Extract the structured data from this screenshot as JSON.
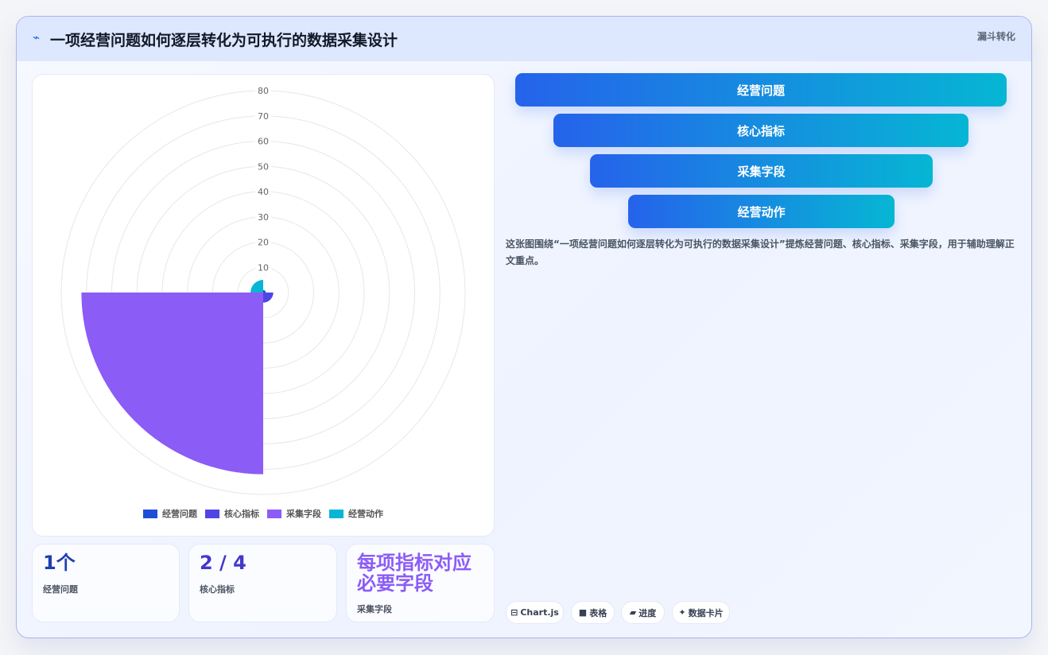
{
  "header": {
    "icon": "chart-line-icon",
    "icon_glyph": "⌁",
    "title": "一项经营问题如何逐层转化为可执行的数据采集设计",
    "tag": "漏斗转化"
  },
  "chart_data": {
    "type": "polarArea",
    "categories": [
      "经营问题",
      "核心指标",
      "采集字段",
      "经营动作"
    ],
    "values": [
      1,
      4,
      72,
      5
    ],
    "colors": [
      "#1d4ed8",
      "#4f46e5",
      "#8b5cf6",
      "#06b6d4"
    ],
    "radial_ticks": [
      10,
      20,
      30,
      40,
      50,
      60,
      70,
      80
    ],
    "rmax": 80,
    "grid": true,
    "legend_position": "bottom"
  },
  "stats": [
    {
      "value": "1个",
      "label": "经营问题",
      "color": "#1e40af"
    },
    {
      "value": "2 / 4",
      "label": "核心指标",
      "color": "#4338ca"
    },
    {
      "value": "每项指标对应必要字段",
      "label": "采集字段",
      "color": "#8b5cf6"
    }
  ],
  "funnel": [
    "经营问题",
    "核心指标",
    "采集字段",
    "经营动作"
  ],
  "description": "这张图围绕“一项经营问题如何逐层转化为可执行的数据采集设计”提炼经营问题、核心指标、采集字段，用于辅助理解正文重点。",
  "chips": [
    {
      "icon": "⊟",
      "label": "Chart.js"
    },
    {
      "icon": "■",
      "label": "表格"
    },
    {
      "icon": "▰",
      "label": "进度"
    },
    {
      "icon": "✦",
      "label": "数据卡片"
    }
  ]
}
